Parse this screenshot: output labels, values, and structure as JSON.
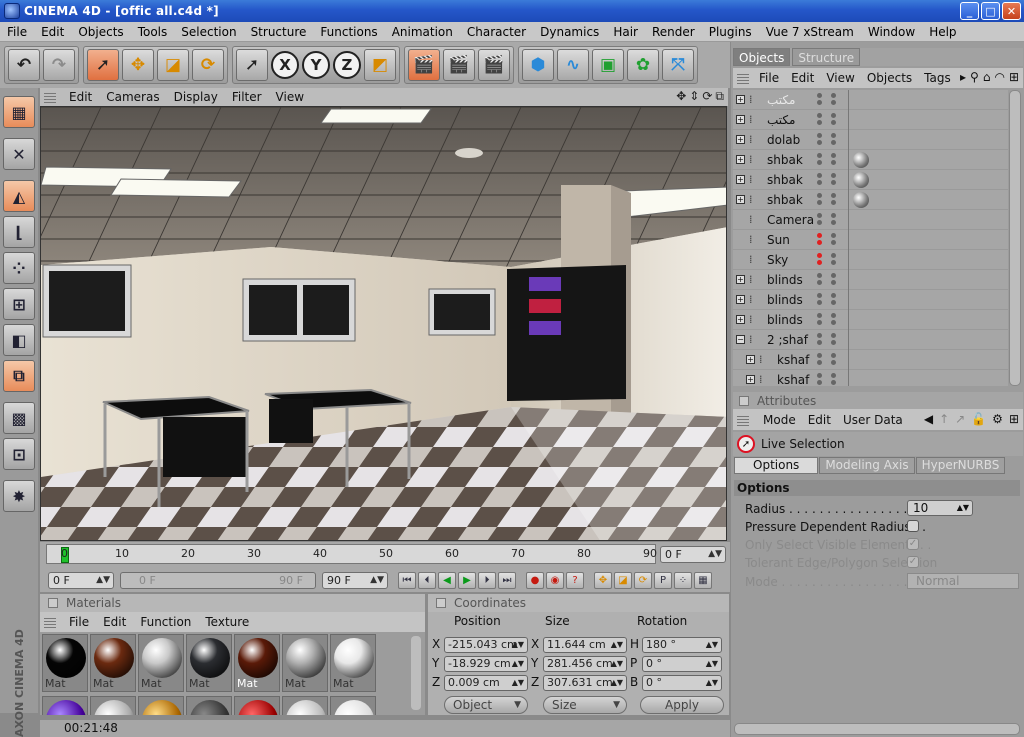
{
  "window": {
    "title": "CINEMA 4D - [offic all.c4d *]",
    "buttons": {
      "minimize": "_",
      "maximize": "□",
      "close": "✕"
    }
  },
  "menu": [
    "File",
    "Edit",
    "Objects",
    "Tools",
    "Selection",
    "Structure",
    "Functions",
    "Animation",
    "Character",
    "Dynamics",
    "Hair",
    "Render",
    "Plugins",
    "Vue 7 xStream",
    "Window",
    "Help"
  ],
  "toolbar": {
    "x_label": "X",
    "y_label": "Y",
    "z_label": "Z"
  },
  "viewport": {
    "menu": [
      "Edit",
      "Cameras",
      "Display",
      "Filter",
      "View"
    ],
    "nav_icons": [
      "✥",
      "⇕",
      "⟳",
      "⧉"
    ]
  },
  "timeline": {
    "ticks": [
      "0",
      "10",
      "20",
      "30",
      "40",
      "50",
      "60",
      "70",
      "80",
      "90"
    ],
    "current_frame": "0 F",
    "start_frame": "0 F",
    "range_start": "0 F",
    "range_end": "90 F",
    "end_frame": "90 F"
  },
  "materials": {
    "title": "Materials",
    "menu": [
      "File",
      "Edit",
      "Function",
      "Texture"
    ],
    "items": [
      {
        "label": "Mat",
        "color": "#050505"
      },
      {
        "label": "Mat",
        "color": "#6b2a10"
      },
      {
        "label": "Mat",
        "color": "#c9c9c9"
      },
      {
        "label": "Mat",
        "color": "#2b2d31"
      },
      {
        "label": "Mat",
        "color": "#5a1a08"
      },
      {
        "label": "Mat",
        "color": "#b0b0b0"
      },
      {
        "label": "Mat",
        "color": "#e8e8e8"
      }
    ]
  },
  "coordinates": {
    "title": "Coordinates",
    "headers": {
      "position": "Position",
      "size": "Size",
      "rotation": "Rotation"
    },
    "axes": [
      "X",
      "Y",
      "Z"
    ],
    "size_axes": [
      "X",
      "Y",
      "Z"
    ],
    "rot_axes": [
      "H",
      "P",
      "B"
    ],
    "position": [
      "-215.043 cm",
      "-18.929 cm",
      "0.009 cm"
    ],
    "size": [
      "11.644 cm",
      "281.456 cm",
      "307.631 cm"
    ],
    "rotation": [
      "180 °",
      "0 °",
      "0 °"
    ],
    "mode_object": "Object",
    "mode_size": "Size",
    "apply": "Apply"
  },
  "status": {
    "time": "00:21:48"
  },
  "objects_panel": {
    "tabs": [
      "Objects",
      "Structure"
    ],
    "menu": [
      "File",
      "Edit",
      "View",
      "Objects",
      "Tags"
    ],
    "items": [
      {
        "name": "مكتب",
        "expander": "+",
        "indent": 0,
        "tag": false,
        "dim": true
      },
      {
        "name": "مكتب",
        "expander": "+",
        "indent": 0,
        "tag": false,
        "dim": false
      },
      {
        "name": "dolab",
        "expander": "+",
        "indent": 0,
        "tag": false,
        "dim": false
      },
      {
        "name": "shbak",
        "expander": "+",
        "indent": 0,
        "tag": true,
        "dim": false
      },
      {
        "name": "shbak",
        "expander": "+",
        "indent": 0,
        "tag": true,
        "dim": false
      },
      {
        "name": "shbak",
        "expander": "+",
        "indent": 0,
        "tag": true,
        "dim": false
      },
      {
        "name": "Camera",
        "expander": "",
        "indent": 0,
        "tag": false,
        "dim": false
      },
      {
        "name": "Sun",
        "expander": "",
        "indent": 0,
        "tag": false,
        "dim": false
      },
      {
        "name": "Sky",
        "expander": "",
        "indent": 0,
        "tag": false,
        "dim": false
      },
      {
        "name": "blinds",
        "expander": "+",
        "indent": 0,
        "tag": false,
        "dim": false
      },
      {
        "name": "blinds",
        "expander": "+",
        "indent": 0,
        "tag": false,
        "dim": false
      },
      {
        "name": "blinds",
        "expander": "+",
        "indent": 0,
        "tag": false,
        "dim": false
      },
      {
        "name": "2 ;shaf",
        "expander": "−",
        "indent": 0,
        "tag": false,
        "dim": false
      },
      {
        "name": "kshaf",
        "expander": "+",
        "indent": 1,
        "tag": false,
        "dim": false
      },
      {
        "name": "kshaf",
        "expander": "+",
        "indent": 1,
        "tag": false,
        "dim": false
      }
    ]
  },
  "attributes": {
    "title": "Attributes",
    "menu": [
      "Mode",
      "Edit",
      "User Data"
    ],
    "tool": "Live Selection",
    "tabs": [
      "Options",
      "Modeling Axis",
      "HyperNURBS"
    ],
    "section": "Options",
    "radius_label": "Radius . . . . . . . . . . . . . . . . . . . .",
    "radius_value": "10",
    "pressure_label": "Pressure Dependent Radius . .",
    "visible_label": "Only Select Visible Elements . .",
    "tolerant_label": "Tolerant Edge/Polygon Selection",
    "mode_label": "Mode . . . . . . . . . . . . . . . . . . . . .",
    "mode_value": "Normal"
  }
}
